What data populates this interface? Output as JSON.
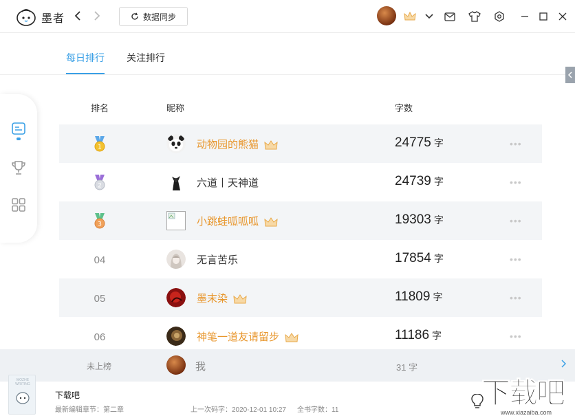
{
  "app": {
    "name": "墨者"
  },
  "toolbar": {
    "sync_label": "数据同步"
  },
  "tabs": [
    {
      "label": "每日排行",
      "active": true
    },
    {
      "label": "关注排行",
      "active": false
    }
  ],
  "table": {
    "headers": {
      "rank": "排名",
      "nickname": "昵称",
      "words": "字数"
    },
    "unit": "字",
    "rows": [
      {
        "rank": "1",
        "medal": "gold",
        "name": "动物园的熊猫",
        "vip": true,
        "count": "24775",
        "avatar": "panda"
      },
      {
        "rank": "2",
        "medal": "silver",
        "name": "六道丨天神道",
        "vip": false,
        "count": "24739",
        "avatar": "dark"
      },
      {
        "rank": "3",
        "medal": "bronze",
        "name": "小跳蛙呱呱呱",
        "vip": true,
        "count": "19303",
        "avatar": "broken"
      },
      {
        "rank": "04",
        "medal": "",
        "name": "无言苦乐",
        "vip": false,
        "count": "17854",
        "avatar": "girl"
      },
      {
        "rank": "05",
        "medal": "",
        "name": "墨末染",
        "vip": true,
        "count": "11809",
        "avatar": "red"
      },
      {
        "rank": "06",
        "medal": "",
        "name": "神笔一道友请留步",
        "vip": true,
        "count": "11186",
        "avatar": "brown"
      }
    ],
    "more_glyph": "•••"
  },
  "my": {
    "rank": "未上榜",
    "name": "我",
    "count": "31 字"
  },
  "footer": {
    "cover_text": "MOZHE WRITING",
    "book_title": "下载吧",
    "latest_chapter": "最新编辑章节：第二章",
    "last_write": "上一次码字：2020-12-01 10:27",
    "total_words": "全书字数：11"
  },
  "watermark": {
    "main": "下载吧",
    "url": "www.xiazaiba.com"
  },
  "colors": {
    "accent": "#3aa0e6",
    "vip": "#e8962c",
    "row_shade": "#f3f5f7"
  }
}
